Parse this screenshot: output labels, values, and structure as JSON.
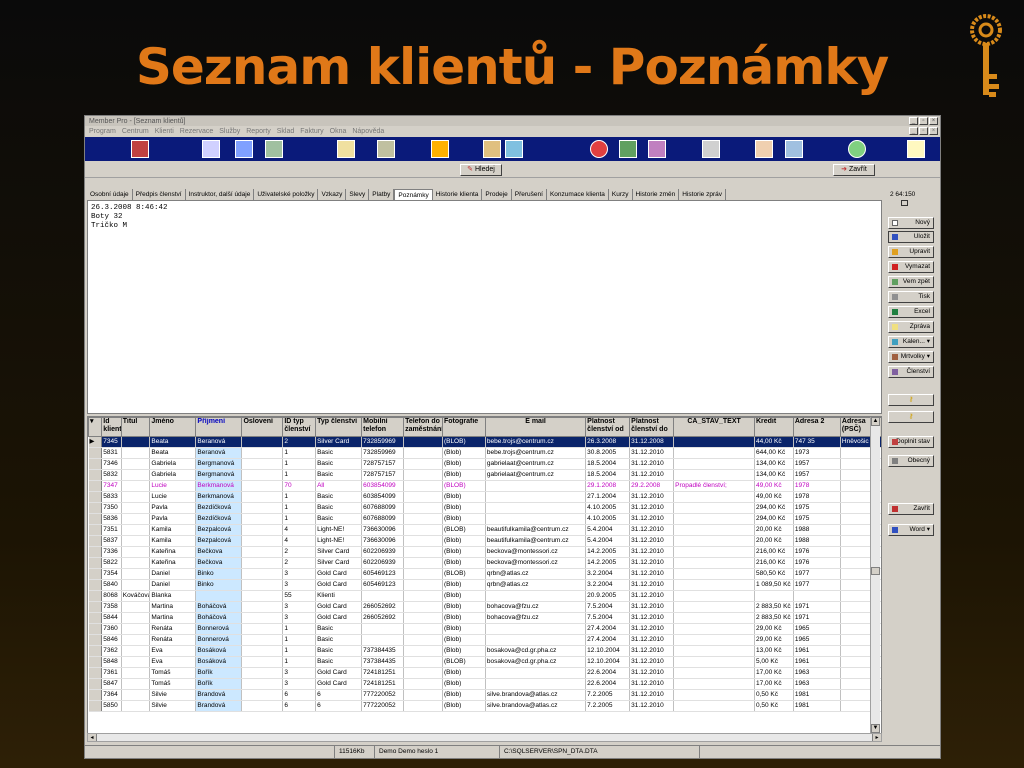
{
  "slide": {
    "title": "Seznam klientů - Poznámky"
  },
  "window": {
    "title": "Member Pro - [Seznam klientů]",
    "menu": [
      "Program",
      "Centrum",
      "Klienti",
      "Rezervace",
      "Služby",
      "Reporty",
      "Sklad",
      "Faktury",
      "Okna",
      "Nápověda"
    ],
    "search_button": "Hledej",
    "close_button": "Zavřít",
    "tabs": [
      "Osobní údaje",
      "Předpis členství",
      "Instruktor, další údaje",
      "Uživatelské položky",
      "Vzkazy",
      "Slevy",
      "Platby",
      "Poznámky",
      "Historie klienta",
      "Prodeje",
      "Přerušení",
      "Konzumace klienta",
      "Kurzy",
      "Historie změn",
      "Historie zpráv"
    ],
    "active_tab": "Poznámky",
    "notes": [
      "26.3.2008 8:46:42",
      "Boty 32",
      "Tričko M"
    ],
    "side_counter": "2 64:150",
    "right_buttons": [
      "Nový",
      "Uložit",
      "Upravit",
      "Vymazat",
      "Vem zpět",
      "Tisk",
      "Excel",
      "Zpráva",
      "Kalen...",
      "Mrtvolky",
      "Členství"
    ],
    "right_buttons_lower": [
      "Doplnit stav",
      "Obecný"
    ],
    "right_buttons_bottom": [
      "Zavřít",
      "Word"
    ],
    "columns": [
      "Id klienta",
      "Titul",
      "Jméno",
      "Příjmení",
      "Oslovení",
      "ID typ členství",
      "Typ členství",
      "Mobilní telefon",
      "Telefon do zaměstnání",
      "Fotografie",
      "E mail",
      "Platnost členství od",
      "Platnost členství do",
      "CA_STAV_TEXT",
      "Kredit",
      "Adresa 2",
      "Adresa (PSČ)"
    ],
    "rows": [
      [
        "7345",
        "",
        "Beata",
        "Beranová",
        "",
        "2",
        "Silver Card",
        "732859969",
        "",
        "(BLOB)",
        "bebe.trojs@centrum.cz",
        "26.3.2008",
        "31.12.2008",
        "",
        "44,00 Kč",
        "747 35",
        "Hněvošic"
      ],
      [
        "5831",
        "",
        "Beata",
        "Beranová",
        "",
        "1",
        "Basic",
        "732859969",
        "",
        "(Blob)",
        "bebe.trojs@centrum.cz",
        "30.8.2005",
        "31.12.2010",
        "",
        "644,00 Kč",
        "1973",
        ""
      ],
      [
        "7346",
        "",
        "Gabriela",
        "Bergmanová",
        "",
        "1",
        "Basic",
        "728757157",
        "",
        "(Blob)",
        "gabrielaat@centrum.cz",
        "18.5.2004",
        "31.12.2010",
        "",
        "134,00 Kč",
        "1957",
        ""
      ],
      [
        "5832",
        "",
        "Gabriela",
        "Bergmanová",
        "",
        "1",
        "Basic",
        "728757157",
        "",
        "(Blob)",
        "gabrielaat@centrum.cz",
        "18.5.2004",
        "31.12.2010",
        "",
        "134,00 Kč",
        "1957",
        ""
      ],
      [
        "7347",
        "",
        "Lucie",
        "Berkmanová",
        "",
        "70",
        "All",
        "603854099",
        "",
        "(BLOB)",
        "",
        "29.1.2008",
        "29.2.2008",
        "Propadlé členství;",
        "49,00 Kč",
        "1978",
        ""
      ],
      [
        "5833",
        "",
        "Lucie",
        "Berkmanová",
        "",
        "1",
        "Basic",
        "603854099",
        "",
        "(Blob)",
        "",
        "27.1.2004",
        "31.12.2010",
        "",
        "49,00 Kč",
        "1978",
        ""
      ],
      [
        "7350",
        "",
        "Pavla",
        "Bezdíčková",
        "",
        "1",
        "Basic",
        "607688099",
        "",
        "(Blob)",
        "",
        "4.10.2005",
        "31.12.2010",
        "",
        "294,00 Kč",
        "1975",
        ""
      ],
      [
        "5836",
        "",
        "Pavla",
        "Bezdíčková",
        "",
        "1",
        "Basic",
        "607688099",
        "",
        "(Blob)",
        "",
        "4.10.2005",
        "31.12.2010",
        "",
        "294,00 Kč",
        "1975",
        ""
      ],
      [
        "7351",
        "",
        "Kamila",
        "Bezpalcová",
        "",
        "4",
        "Light-NE!",
        "736630096",
        "",
        "(BLOB)",
        "beautifulkamila@centrum.cz",
        "5.4.2004",
        "31.12.2010",
        "",
        "20,00 Kč",
        "1988",
        ""
      ],
      [
        "5837",
        "",
        "Kamila",
        "Bezpalcová",
        "",
        "4",
        "Light-NE!",
        "736630096",
        "",
        "(Blob)",
        "beautifulkamila@centrum.cz",
        "5.4.2004",
        "31.12.2010",
        "",
        "20,00 Kč",
        "1988",
        ""
      ],
      [
        "7336",
        "",
        "Kateřina",
        "Bečkova",
        "",
        "2",
        "Silver Card",
        "602206939",
        "",
        "(Blob)",
        "beckova@montessori.cz",
        "14.2.2005",
        "31.12.2010",
        "",
        "216,00 Kč",
        "1976",
        ""
      ],
      [
        "5822",
        "",
        "Kateřina",
        "Bečkova",
        "",
        "2",
        "Silver Card",
        "602206939",
        "",
        "(Blob)",
        "beckova@montessori.cz",
        "14.2.2005",
        "31.12.2010",
        "",
        "216,00 Kč",
        "1976",
        ""
      ],
      [
        "7354",
        "",
        "Daniel",
        "Binko",
        "",
        "3",
        "Gold Card",
        "605469123",
        "",
        "(BLOB)",
        "qrbn@atlas.cz",
        "3.2.2004",
        "31.12.2010",
        "",
        "580,50 Kč",
        "1977",
        ""
      ],
      [
        "5840",
        "",
        "Daniel",
        "Binko",
        "",
        "3",
        "Gold Card",
        "605469123",
        "",
        "(Blob)",
        "qrbn@atlas.cz",
        "3.2.2004",
        "31.12.2010",
        "",
        "1 089,50 Kč",
        "1977",
        ""
      ],
      [
        "8068",
        "Kováčová",
        "Blanka",
        "",
        "",
        "55",
        "Klienti",
        "",
        "",
        "(Blob)",
        "",
        "20.9.2005",
        "31.12.2010",
        "",
        "",
        "",
        ""
      ],
      [
        "7358",
        "",
        "Martina",
        "Boháčová",
        "",
        "3",
        "Gold Card",
        "266052692",
        "",
        "(Blob)",
        "bohacova@fzu.cz",
        "7.5.2004",
        "31.12.2010",
        "",
        "2 883,50 Kč",
        "1971",
        ""
      ],
      [
        "5844",
        "",
        "Martina",
        "Boháčová",
        "",
        "3",
        "Gold Card",
        "266052692",
        "",
        "(Blob)",
        "bohacova@fzu.cz",
        "7.5.2004",
        "31.12.2010",
        "",
        "2 883,50 Kč",
        "1971",
        ""
      ],
      [
        "7360",
        "",
        "Renáta",
        "Bonnerová",
        "",
        "1",
        "Basic",
        "",
        "",
        "(Blob)",
        "",
        "27.4.2004",
        "31.12.2010",
        "",
        "29,00 Kč",
        "1965",
        ""
      ],
      [
        "5846",
        "",
        "Renáta",
        "Bonnerová",
        "",
        "1",
        "Basic",
        "",
        "",
        "(Blob)",
        "",
        "27.4.2004",
        "31.12.2010",
        "",
        "29,00 Kč",
        "1965",
        ""
      ],
      [
        "7362",
        "",
        "Eva",
        "Bosáková",
        "",
        "1",
        "Basic",
        "737384435",
        "",
        "(Blob)",
        "bosakova@cd.gr.pha.cz",
        "12.10.2004",
        "31.12.2010",
        "",
        "13,00 Kč",
        "1961",
        ""
      ],
      [
        "5848",
        "",
        "Eva",
        "Bosáková",
        "",
        "1",
        "Basic",
        "737384435",
        "",
        "(BLOB)",
        "bosakova@cd.gr.pha.cz",
        "12.10.2004",
        "31.12.2010",
        "",
        "5,00 Kč",
        "1961",
        ""
      ],
      [
        "7361",
        "",
        "Tomáš",
        "Bořík",
        "",
        "3",
        "Gold Card",
        "724181251",
        "",
        "(Blob)",
        "",
        "22.6.2004",
        "31.12.2010",
        "",
        "17,00 Kč",
        "1963",
        ""
      ],
      [
        "5847",
        "",
        "Tomáš",
        "Bořík",
        "",
        "3",
        "Gold Card",
        "724181251",
        "",
        "(Blob)",
        "",
        "22.6.2004",
        "31.12.2010",
        "",
        "17,00 Kč",
        "1963",
        ""
      ],
      [
        "7364",
        "",
        "Silvie",
        "Brandová",
        "",
        "6",
        "6",
        "777220052",
        "",
        "(Blob)",
        "silve.brandova@atlas.cz",
        "7.2.2005",
        "31.12.2010",
        "",
        "0,50 Kč",
        "1981",
        ""
      ],
      [
        "5850",
        "",
        "Silvie",
        "Brandová",
        "",
        "6",
        "6",
        "777220052",
        "",
        "(Blob)",
        "silve.brandova@atlas.cz",
        "7.2.2005",
        "31.12.2010",
        "",
        "0,50 Kč",
        "1981",
        ""
      ]
    ],
    "status": [
      "11516Kb",
      "Demo Demo heslo 1",
      "C:\\SQLSERVER\\SPN_DTA.DTA"
    ]
  }
}
